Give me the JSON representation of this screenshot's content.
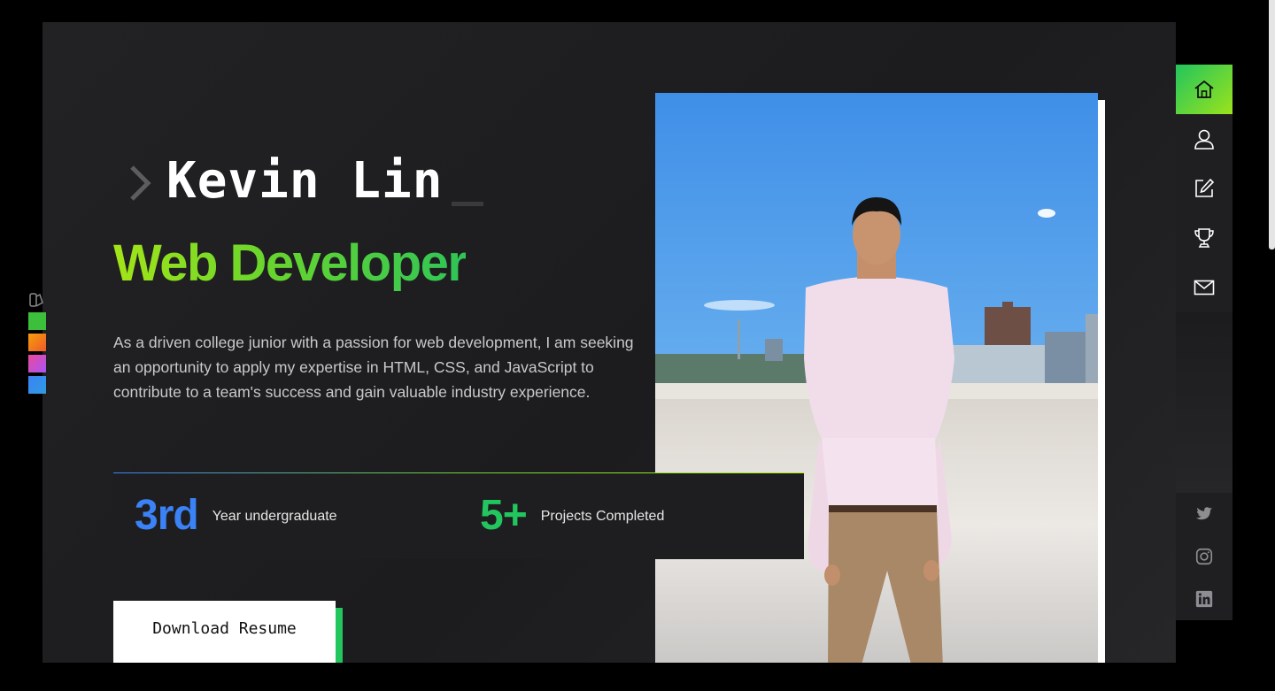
{
  "hero": {
    "name": "Kevin Lin",
    "role": "Web Developer",
    "bio": "As a driven college junior with a passion for web development, I am seeking an opportunity to apply my expertise in HTML, CSS, and JavaScript to contribute to a team's success and gain valuable industry experience.",
    "resume_label": "Download Resume"
  },
  "stats": [
    {
      "value": "3rd",
      "label": "Year undergraduate",
      "color": "#3b82f6"
    },
    {
      "value": "5+",
      "label": "Projects Completed",
      "color": "#22c55e"
    }
  ],
  "theme_swatches": {
    "icon": "palette-icon",
    "colors": [
      "#3cc03c",
      "#f07a2a",
      "#d64fb0",
      "#3a8ef0"
    ]
  },
  "nav": {
    "items": [
      {
        "icon": "home-icon",
        "active": true
      },
      {
        "icon": "user-icon",
        "active": false
      },
      {
        "icon": "edit-icon",
        "active": false
      },
      {
        "icon": "trophy-icon",
        "active": false
      },
      {
        "icon": "mail-icon",
        "active": false
      }
    ],
    "social": [
      "twitter-icon",
      "instagram-icon",
      "linkedin-icon"
    ]
  },
  "colors": {
    "accent_green": "#22c55e",
    "accent_lime": "#a3e418",
    "accent_blue": "#3b82f6",
    "panel_bg": "#1f1f21"
  }
}
